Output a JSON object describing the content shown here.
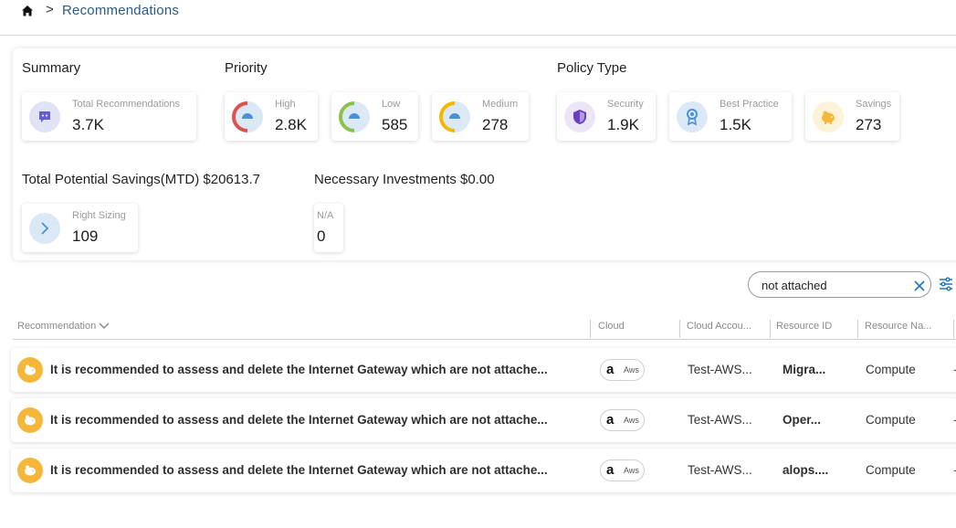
{
  "breadcrumb": {
    "title": "Recommendations",
    "separator": ">"
  },
  "summary": {
    "title": "Summary",
    "cards": [
      {
        "label": "Total Recommendations",
        "value": "3.7K"
      }
    ]
  },
  "priority": {
    "title": "Priority",
    "cards": [
      {
        "label": "High",
        "value": "2.8K",
        "color": "#d9534f"
      },
      {
        "label": "Low",
        "value": "585",
        "color": "#8bc34a"
      },
      {
        "label": "Medium",
        "value": "278",
        "color": "#f5b800"
      }
    ]
  },
  "policy_type": {
    "title": "Policy Type",
    "cards": [
      {
        "label": "Security",
        "value": "1.9K"
      },
      {
        "label": "Best Practice",
        "value": "1.5K"
      },
      {
        "label": "Savings",
        "value": "273"
      }
    ]
  },
  "savings": {
    "title": "Total Potential Savings(MTD) $20613.7",
    "cards": [
      {
        "label": "Right Sizing",
        "value": "109"
      }
    ]
  },
  "investments": {
    "title": "Necessary Investments $0.00",
    "cards": [
      {
        "label": "N/A",
        "value": "0"
      }
    ]
  },
  "search": {
    "value": "not attached"
  },
  "table": {
    "columns": [
      "Recommendation",
      "Cloud",
      "Cloud Accou...",
      "Resource ID",
      "Resource Na..."
    ],
    "rows": [
      {
        "recommendation": "It is recommended to assess and delete the Internet Gateway which are not attache...",
        "cloud": "Aws",
        "cloud_logo": "a",
        "account": "Test-AWS...",
        "resource_id": "Migra...",
        "resource_name": "Compute",
        "more": "-"
      },
      {
        "recommendation": "It is recommended to assess and delete the Internet Gateway which are not attache...",
        "cloud": "Aws",
        "cloud_logo": "a",
        "account": "Test-AWS...",
        "resource_id": "Oper...",
        "resource_name": "Compute",
        "more": "-"
      },
      {
        "recommendation": "It is recommended to assess and delete the Internet Gateway which are not attache...",
        "cloud": "Aws",
        "cloud_logo": "a",
        "account": "Test-AWS...",
        "resource_id": "alops....",
        "resource_name": "Compute",
        "more": "-"
      }
    ]
  },
  "colors": {
    "accent": "#2c5a86",
    "link_blue": "#1a73c9",
    "savings_yellow": "#f5b73a"
  }
}
